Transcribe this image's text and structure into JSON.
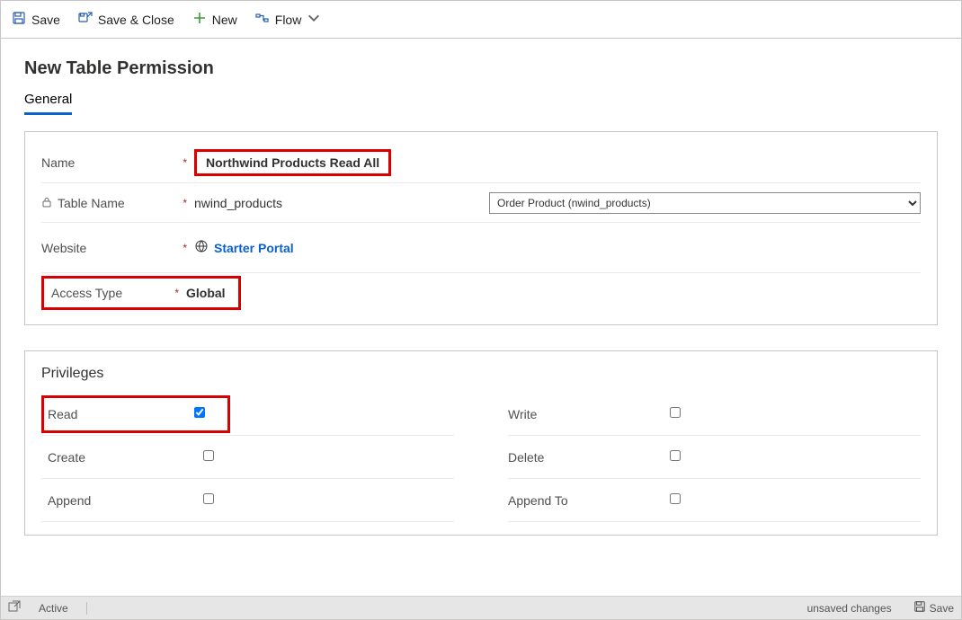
{
  "cmdbar": {
    "save": "Save",
    "save_close": "Save & Close",
    "new": "New",
    "flow": "Flow"
  },
  "page": {
    "title": "New Table Permission"
  },
  "tabs": {
    "general": "General"
  },
  "fields": {
    "name_label": "Name",
    "name_value": "Northwind Products Read All",
    "table_label": "Table Name",
    "table_value": "nwind_products",
    "table_select": "Order Product (nwind_products)",
    "website_label": "Website",
    "website_value": "Starter Portal",
    "access_label": "Access Type",
    "access_value": "Global"
  },
  "privileges": {
    "section_title": "Privileges",
    "read": "Read",
    "write": "Write",
    "create": "Create",
    "delete": "Delete",
    "append": "Append",
    "append_to": "Append To"
  },
  "status": {
    "active": "Active",
    "unsaved": "unsaved changes",
    "save": "Save"
  }
}
